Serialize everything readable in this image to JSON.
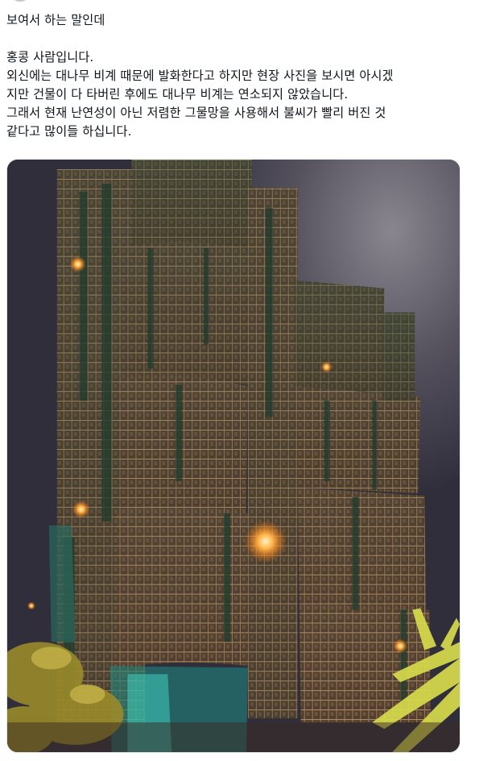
{
  "post": {
    "lines": [
      "보여서 하는 말인데",
      "",
      "홍콩 사람입니다.",
      "외신에는 대나무 비계 때문에 발화한다고 하지만 현장 사진을 보시면 아시겠",
      "지만 건물이 다 타버린 후에도 대나무 비계는 연소되지 않았습니다.",
      "그래서 현재 난연성이 아닌 저렴한 그물망을 사용해서 불씨가 빨리 버진 것",
      "같다고 많이들 하십니다."
    ]
  },
  "media": {
    "icon": "photo-burned-building-bamboo-scaffolding",
    "colors": {
      "sky": "#2f2e3a",
      "sky_smoke": "#6f6c74",
      "building": "#6b4a35",
      "scaffold": "#c9a27a",
      "net": "#2f5a43",
      "glow": "#ffb347",
      "fire": "#ff8a1f",
      "palm": "#c8d04a",
      "teal_net": "#3fd0c0"
    }
  }
}
